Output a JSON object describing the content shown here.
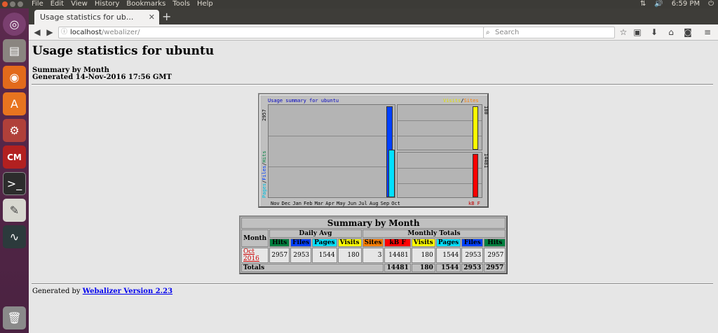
{
  "menubar": {
    "items": [
      "File",
      "Edit",
      "View",
      "History",
      "Bookmarks",
      "Tools",
      "Help"
    ],
    "clock": "6:59 PM"
  },
  "browser": {
    "tab_title": "Usage statistics for ub...",
    "url_host": "localhost",
    "url_path": "/webalizer/",
    "search_placeholder": "Search"
  },
  "page": {
    "title": "Usage statistics for ubuntu",
    "summary_by_month": "Summary by Month",
    "generated": "Generated 14-Nov-2016 17:56 GMT",
    "footer_prefix": "Generated by",
    "footer_link": "Webalizer Version 2.23"
  },
  "graph": {
    "title": "Usage summary for ubuntu",
    "legend_visits": "Visits",
    "legend_sep": "/",
    "legend_sites": "Sites",
    "left_max_label": "2957",
    "left_axis_pages": "Pages",
    "left_axis_files": "Files",
    "left_axis_hits": "Hits",
    "right_top_label": "180",
    "right_bottom_label": "14481",
    "kb_label": "kB F",
    "months": [
      "Nov",
      "Dec",
      "Jan",
      "Feb",
      "Mar",
      "Apr",
      "May",
      "Jun",
      "Jul",
      "Aug",
      "Sep",
      "Oct"
    ]
  },
  "chart_data": {
    "type": "bar",
    "title": "Usage summary for ubuntu",
    "categories": [
      "Nov",
      "Dec",
      "Jan",
      "Feb",
      "Mar",
      "Apr",
      "May",
      "Jun",
      "Jul",
      "Aug",
      "Sep",
      "Oct"
    ],
    "series": [
      {
        "name": "Hits",
        "values": [
          0,
          0,
          0,
          0,
          0,
          0,
          0,
          0,
          0,
          0,
          0,
          2957
        ]
      },
      {
        "name": "Files",
        "values": [
          0,
          0,
          0,
          0,
          0,
          0,
          0,
          0,
          0,
          0,
          0,
          2953
        ]
      },
      {
        "name": "Pages",
        "values": [
          0,
          0,
          0,
          0,
          0,
          0,
          0,
          0,
          0,
          0,
          0,
          1544
        ]
      },
      {
        "name": "Visits",
        "values": [
          0,
          0,
          0,
          0,
          0,
          0,
          0,
          0,
          0,
          0,
          0,
          180
        ]
      },
      {
        "name": "Sites",
        "values": [
          0,
          0,
          0,
          0,
          0,
          0,
          0,
          0,
          0,
          0,
          0,
          3
        ]
      },
      {
        "name": "kB F",
        "values": [
          0,
          0,
          0,
          0,
          0,
          0,
          0,
          0,
          0,
          0,
          0,
          14481
        ]
      }
    ]
  },
  "table": {
    "caption": "Summary by Month",
    "month_header": "Month",
    "daily_avg": "Daily Avg",
    "monthly_totals": "Monthly Totals",
    "daily_cols": [
      "Hits",
      "Files",
      "Pages",
      "Visits"
    ],
    "monthly_cols": [
      "Sites",
      "kB F",
      "Visits",
      "Pages",
      "Files",
      "Hits"
    ],
    "row": {
      "month": "Oct 2016",
      "values": [
        "2957",
        "2953",
        "1544",
        "180",
        "3",
        "14481",
        "180",
        "1544",
        "2953",
        "2957"
      ]
    },
    "totals_label": "Totals",
    "totals": [
      "14481",
      "180",
      "1544",
      "2953",
      "2957"
    ]
  },
  "colors": {
    "hits": "#008040",
    "files": "#0040ff",
    "pages": "#00e0ff",
    "visits": "#ffff00",
    "sites": "#ff8000",
    "kbf": "#ff0000"
  }
}
